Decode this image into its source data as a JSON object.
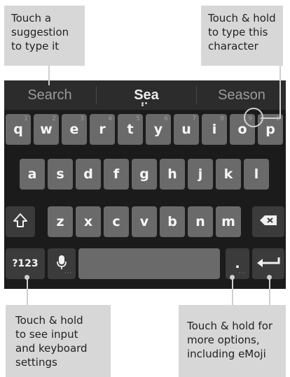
{
  "callouts": {
    "top_left": "Touch a\nsuggestion\nto type it",
    "top_right": "Touch & hold\nto type this\ncharacter",
    "bottom_left": "Touch & hold\nto see input\nand keyboard\nsettings",
    "bottom_right": "Touch & hold for\nmore options,\nincluding eMoji"
  },
  "suggestions": [
    "Search",
    "Sea",
    "Season"
  ],
  "keyboard": {
    "row1": [
      {
        "key": "q",
        "hint": "1"
      },
      {
        "key": "w",
        "hint": "2"
      },
      {
        "key": "e",
        "hint": "3"
      },
      {
        "key": "r",
        "hint": "4"
      },
      {
        "key": "t",
        "hint": "5"
      },
      {
        "key": "y",
        "hint": "6"
      },
      {
        "key": "u",
        "hint": "7"
      },
      {
        "key": "i",
        "hint": "8"
      },
      {
        "key": "o",
        "hint": "9"
      },
      {
        "key": "p",
        "hint": "0"
      }
    ],
    "row2": [
      "a",
      "s",
      "d",
      "f",
      "g",
      "h",
      "j",
      "k",
      "l"
    ],
    "row3": [
      "z",
      "x",
      "c",
      "v",
      "b",
      "n",
      "m"
    ],
    "symbols_label": "?123",
    "period_label": ".",
    "icons": {
      "shift": "shift-arrow-icon",
      "backspace": "backspace-icon",
      "mic": "microphone-icon",
      "enter": "enter-arrow-icon"
    }
  }
}
